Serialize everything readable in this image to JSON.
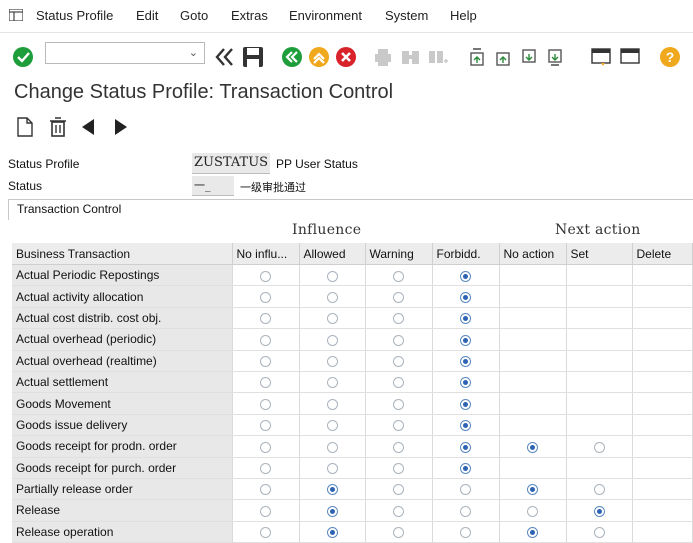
{
  "menu": [
    "Status Profile",
    "Edit",
    "Goto",
    "Extras",
    "Environment",
    "System",
    "Help"
  ],
  "title": "Change Status Profile: Transaction Control",
  "status_profile": {
    "label": "Status Profile",
    "value": "ZUSTATUS",
    "desc": "PP User Status"
  },
  "status": {
    "label": "Status",
    "value": "一_",
    "desc": "一级审批通过"
  },
  "group_title": "Transaction Control",
  "group_headers": {
    "influence": "Influence",
    "next_action": "Next action"
  },
  "columns": [
    "Business Transaction",
    "No influ...",
    "Allowed",
    "Warning",
    "Forbidd.",
    "No action",
    "Set",
    "Delete"
  ],
  "rows": [
    {
      "name": "Actual Periodic Repostings",
      "influence": "Forbidd.",
      "next": null
    },
    {
      "name": "Actual activity allocation",
      "influence": "Forbidd.",
      "next": null
    },
    {
      "name": "Actual cost distrib. cost obj.",
      "influence": "Forbidd.",
      "next": null
    },
    {
      "name": "Actual overhead (periodic)",
      "influence": "Forbidd.",
      "next": null
    },
    {
      "name": "Actual overhead (realtime)",
      "influence": "Forbidd.",
      "next": null
    },
    {
      "name": "Actual settlement",
      "influence": "Forbidd.",
      "next": null
    },
    {
      "name": "Goods Movement",
      "influence": "Forbidd.",
      "next": null
    },
    {
      "name": "Goods issue delivery",
      "influence": "Forbidd.",
      "next": null
    },
    {
      "name": "Goods receipt for prodn. order",
      "influence": "Forbidd.",
      "next": "No action"
    },
    {
      "name": "Goods receipt for purch. order",
      "influence": "Forbidd.",
      "next": null
    },
    {
      "name": "Partially release order",
      "influence": "Allowed",
      "next": "No action"
    },
    {
      "name": "Release",
      "influence": "Allowed",
      "next": "Set"
    },
    {
      "name": "Release operation",
      "influence": "Allowed",
      "next": "No action"
    }
  ]
}
